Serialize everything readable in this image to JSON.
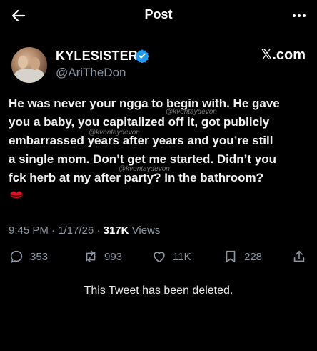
{
  "header": {
    "title": "Post",
    "back_icon": "arrow-left-icon",
    "more_icon": "more-dots-icon"
  },
  "author": {
    "display_name": "KYLESISTER",
    "handle": "@AriTheDon",
    "verified_icon": "verified-badge-icon",
    "verified_color": "#1d9bf0"
  },
  "brand": {
    "label": "𝕏.com"
  },
  "tweet": {
    "lines": [
      "He was never your ngga to begin with. He gave",
      "you a baby, you capitalized off it, got publicly",
      "embarrassed years after years and you’re still",
      "a single mom. Don’t get me started. Didn’t you",
      "fck herb at my after party? In the bathroom?"
    ],
    "emoji_icon": "kiss-mark-icon"
  },
  "watermarks": [
    "@kvontaydevon",
    "@kvontaydevon",
    "@kvontaydevon"
  ],
  "meta": {
    "time": "9:45 PM",
    "date": "1/17/26",
    "views_count": "317K",
    "views_label": "Views"
  },
  "actions": {
    "replies": "353",
    "reposts": "993",
    "likes": "11K",
    "bookmarks": "228"
  },
  "notice": "This Tweet has been deleted."
}
